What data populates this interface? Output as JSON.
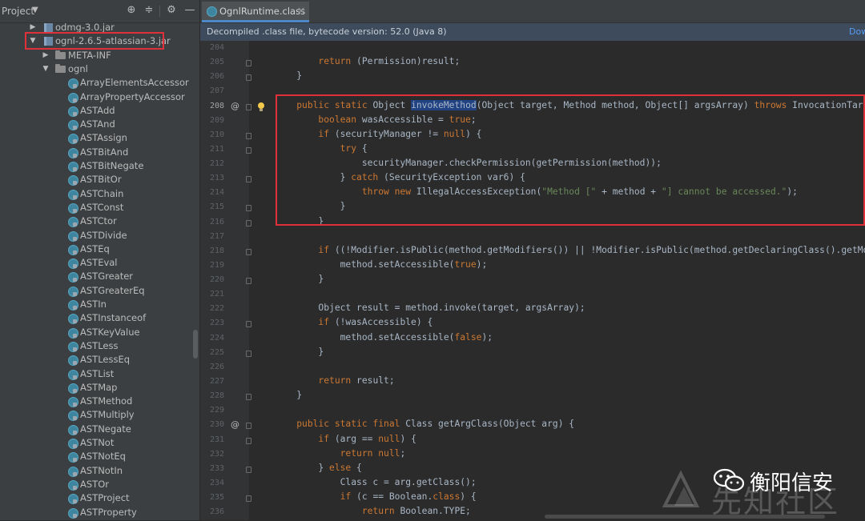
{
  "project_panel": {
    "title": "Project",
    "header_icons": [
      "crosshair-icon",
      "collapse-icon",
      "gear-icon",
      "minimize-icon"
    ],
    "tree": [
      {
        "label": "odmg-3.0.jar",
        "type": "jar",
        "expanded": false
      },
      {
        "label": "ognl-2.6.5-atlassian-3.jar",
        "type": "jar",
        "expanded": true,
        "highlighted": true
      },
      {
        "label": "META-INF",
        "type": "folder",
        "expanded": false
      },
      {
        "label": "ognl",
        "type": "package",
        "expanded": true
      },
      {
        "label": "ArrayElementsAccessor",
        "type": "class"
      },
      {
        "label": "ArrayPropertyAccessor",
        "type": "class"
      },
      {
        "label": "ASTAdd",
        "type": "class"
      },
      {
        "label": "ASTAnd",
        "type": "class"
      },
      {
        "label": "ASTAssign",
        "type": "class"
      },
      {
        "label": "ASTBitAnd",
        "type": "class"
      },
      {
        "label": "ASTBitNegate",
        "type": "class"
      },
      {
        "label": "ASTBitOr",
        "type": "class"
      },
      {
        "label": "ASTChain",
        "type": "class"
      },
      {
        "label": "ASTConst",
        "type": "class"
      },
      {
        "label": "ASTCtor",
        "type": "class"
      },
      {
        "label": "ASTDivide",
        "type": "class"
      },
      {
        "label": "ASTEq",
        "type": "class"
      },
      {
        "label": "ASTEval",
        "type": "class"
      },
      {
        "label": "ASTGreater",
        "type": "class"
      },
      {
        "label": "ASTGreaterEq",
        "type": "class"
      },
      {
        "label": "ASTIn",
        "type": "class"
      },
      {
        "label": "ASTInstanceof",
        "type": "class"
      },
      {
        "label": "ASTKeyValue",
        "type": "class"
      },
      {
        "label": "ASTLess",
        "type": "class"
      },
      {
        "label": "ASTLessEq",
        "type": "class"
      },
      {
        "label": "ASTList",
        "type": "class"
      },
      {
        "label": "ASTMap",
        "type": "class"
      },
      {
        "label": "ASTMethod",
        "type": "class"
      },
      {
        "label": "ASTMultiply",
        "type": "class"
      },
      {
        "label": "ASTNegate",
        "type": "class"
      },
      {
        "label": "ASTNot",
        "type": "class"
      },
      {
        "label": "ASTNotEq",
        "type": "class"
      },
      {
        "label": "ASTNotIn",
        "type": "class"
      },
      {
        "label": "ASTOr",
        "type": "class"
      },
      {
        "label": "ASTProject",
        "type": "class"
      },
      {
        "label": "ASTProperty",
        "type": "class"
      }
    ]
  },
  "editor": {
    "tab": {
      "label": "OgnlRuntime.class",
      "close": "×"
    },
    "notice": {
      "text": "Decompiled .class file, bytecode version: 52.0 (Java 8)",
      "link": "Dow"
    },
    "lines": [
      {
        "n": "204",
        "segs": []
      },
      {
        "n": "205",
        "segs": [
          {
            "t": "        "
          },
          {
            "t": "return",
            "c": "kw"
          },
          {
            "t": " (Permission)result;"
          }
        ]
      },
      {
        "n": "206",
        "segs": [
          {
            "t": "    }"
          }
        ]
      },
      {
        "n": "207",
        "segs": []
      },
      {
        "n": "208",
        "active": true,
        "at": true,
        "bulb": true,
        "segs": [
          {
            "t": "    "
          },
          {
            "t": "public static",
            "c": "kw"
          },
          {
            "t": " Object "
          },
          {
            "t": "invokeMethod",
            "c": "hl"
          },
          {
            "t": "(Object target, Method method, Object[] argsArray) "
          },
          {
            "t": "throws",
            "c": "kw"
          },
          {
            "t": " InvocationTarget"
          }
        ]
      },
      {
        "n": "209",
        "segs": [
          {
            "t": "        "
          },
          {
            "t": "boolean",
            "c": "kw"
          },
          {
            "t": " wasAccessible = "
          },
          {
            "t": "true",
            "c": "kw"
          },
          {
            "t": ";"
          }
        ]
      },
      {
        "n": "210",
        "segs": [
          {
            "t": "        "
          },
          {
            "t": "if",
            "c": "kw"
          },
          {
            "t": " (securityManager != "
          },
          {
            "t": "null",
            "c": "kw"
          },
          {
            "t": ") {"
          }
        ]
      },
      {
        "n": "211",
        "segs": [
          {
            "t": "            "
          },
          {
            "t": "try",
            "c": "kw"
          },
          {
            "t": " {"
          }
        ]
      },
      {
        "n": "212",
        "segs": [
          {
            "t": "                securityManager.checkPermission(getPermission(method));"
          }
        ]
      },
      {
        "n": "213",
        "segs": [
          {
            "t": "            } "
          },
          {
            "t": "catch",
            "c": "kw"
          },
          {
            "t": " (SecurityException var6) {"
          }
        ]
      },
      {
        "n": "214",
        "segs": [
          {
            "t": "                "
          },
          {
            "t": "throw new",
            "c": "kw"
          },
          {
            "t": " IllegalAccessException("
          },
          {
            "t": "\"Method [\"",
            "c": "str"
          },
          {
            "t": " + method + "
          },
          {
            "t": "\"] cannot be accessed.\"",
            "c": "str"
          },
          {
            "t": ");"
          }
        ]
      },
      {
        "n": "215",
        "segs": [
          {
            "t": "            }"
          }
        ]
      },
      {
        "n": "216",
        "segs": [
          {
            "t": "        }"
          }
        ]
      },
      {
        "n": "217",
        "segs": []
      },
      {
        "n": "218",
        "segs": [
          {
            "t": "        "
          },
          {
            "t": "if",
            "c": "kw"
          },
          {
            "t": " ((!Modifier.isPublic(method.getModifiers()) || !Modifier.isPublic(method.getDeclaringClass().getModi"
          }
        ]
      },
      {
        "n": "219",
        "segs": [
          {
            "t": "            method.setAccessible("
          },
          {
            "t": "true",
            "c": "kw"
          },
          {
            "t": ");"
          }
        ]
      },
      {
        "n": "220",
        "segs": [
          {
            "t": "        }"
          }
        ]
      },
      {
        "n": "221",
        "segs": []
      },
      {
        "n": "222",
        "segs": [
          {
            "t": "        Object result = method.invoke(target, argsArray);"
          }
        ]
      },
      {
        "n": "223",
        "segs": [
          {
            "t": "        "
          },
          {
            "t": "if",
            "c": "kw"
          },
          {
            "t": " (!wasAccessible) {"
          }
        ]
      },
      {
        "n": "224",
        "segs": [
          {
            "t": "            method.setAccessible("
          },
          {
            "t": "false",
            "c": "kw"
          },
          {
            "t": ");"
          }
        ]
      },
      {
        "n": "225",
        "segs": [
          {
            "t": "        }"
          }
        ]
      },
      {
        "n": "226",
        "segs": []
      },
      {
        "n": "227",
        "segs": [
          {
            "t": "        "
          },
          {
            "t": "return",
            "c": "kw"
          },
          {
            "t": " result;"
          }
        ]
      },
      {
        "n": "228",
        "segs": [
          {
            "t": "    }"
          }
        ]
      },
      {
        "n": "229",
        "segs": []
      },
      {
        "n": "230",
        "at": true,
        "segs": [
          {
            "t": "    "
          },
          {
            "t": "public static final",
            "c": "kw"
          },
          {
            "t": " Class getArgClass(Object arg) {"
          }
        ]
      },
      {
        "n": "231",
        "segs": [
          {
            "t": "        "
          },
          {
            "t": "if",
            "c": "kw"
          },
          {
            "t": " (arg == "
          },
          {
            "t": "null",
            "c": "kw"
          },
          {
            "t": ") {"
          }
        ]
      },
      {
        "n": "232",
        "segs": [
          {
            "t": "            "
          },
          {
            "t": "return null",
            "c": "kw"
          },
          {
            "t": ";"
          }
        ]
      },
      {
        "n": "233",
        "segs": [
          {
            "t": "        } "
          },
          {
            "t": "else",
            "c": "kw"
          },
          {
            "t": " {"
          }
        ]
      },
      {
        "n": "234",
        "segs": [
          {
            "t": "            Class c = arg.getClass();"
          }
        ]
      },
      {
        "n": "235",
        "segs": [
          {
            "t": "            "
          },
          {
            "t": "if",
            "c": "kw"
          },
          {
            "t": " (c == Boolean."
          },
          {
            "t": "class",
            "c": "kw"
          },
          {
            "t": ") {"
          }
        ]
      },
      {
        "n": "236",
        "segs": [
          {
            "t": "                "
          },
          {
            "t": "return",
            "c": "kw"
          },
          {
            "t": " Boolean.TYPE;"
          }
        ]
      }
    ],
    "fold_markers": [
      "205",
      "206",
      "208",
      "210",
      "211",
      "213",
      "215",
      "216",
      "218",
      "220",
      "223",
      "225",
      "228",
      "230",
      "231",
      "233",
      "235"
    ]
  },
  "watermark": {
    "site": "先知社区",
    "account": "衡阳信安"
  },
  "colors": {
    "keyword": "#cc7832",
    "string": "#6a8759",
    "text": "#a9b7c6",
    "highlight_box": "#e0303a",
    "selection": "#214283"
  }
}
